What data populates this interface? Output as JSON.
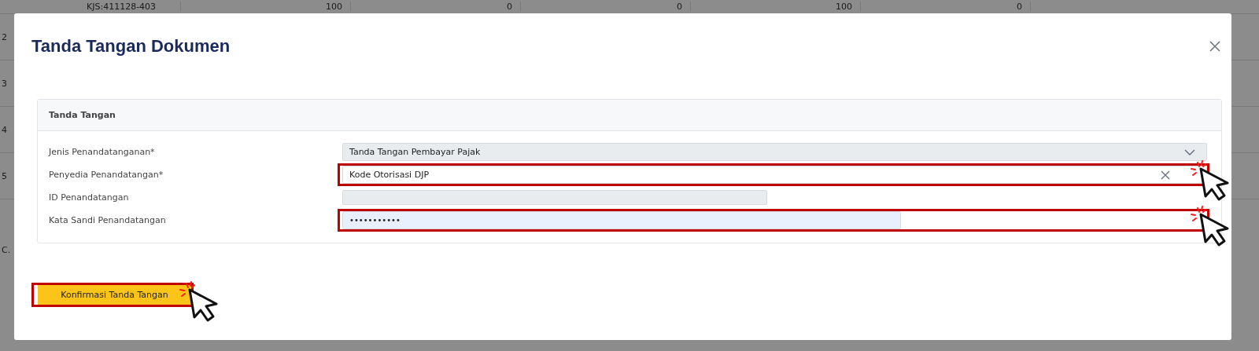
{
  "background_table": {
    "row_numbers": [
      "2",
      "3",
      "4",
      "5"
    ],
    "top_row": [
      "KJS:411128-403",
      "100",
      "0",
      "0",
      "100",
      "0"
    ],
    "footer_text": "C."
  },
  "dialog": {
    "title": "Tanda Tangan Dokumen",
    "card": {
      "title": "Tanda Tangan",
      "fields": [
        {
          "label": "Jenis Penandatanganan*",
          "kind": "select",
          "value": "Tanda Tangan Pembayar Pajak",
          "highlighted": false
        },
        {
          "label": "Penyedia Penandatangan*",
          "kind": "clearable",
          "value": "Kode Otorisasi DJP",
          "highlighted": true
        },
        {
          "label": "ID Penandatangan",
          "kind": "disabled",
          "highlighted": false
        },
        {
          "label": "Kata Sandi Penandatangan",
          "kind": "password",
          "value": "•••••••••••",
          "highlighted": true
        }
      ]
    },
    "button": {
      "label": "Konfirmasi Tanda Tangan",
      "highlighted": true
    }
  }
}
